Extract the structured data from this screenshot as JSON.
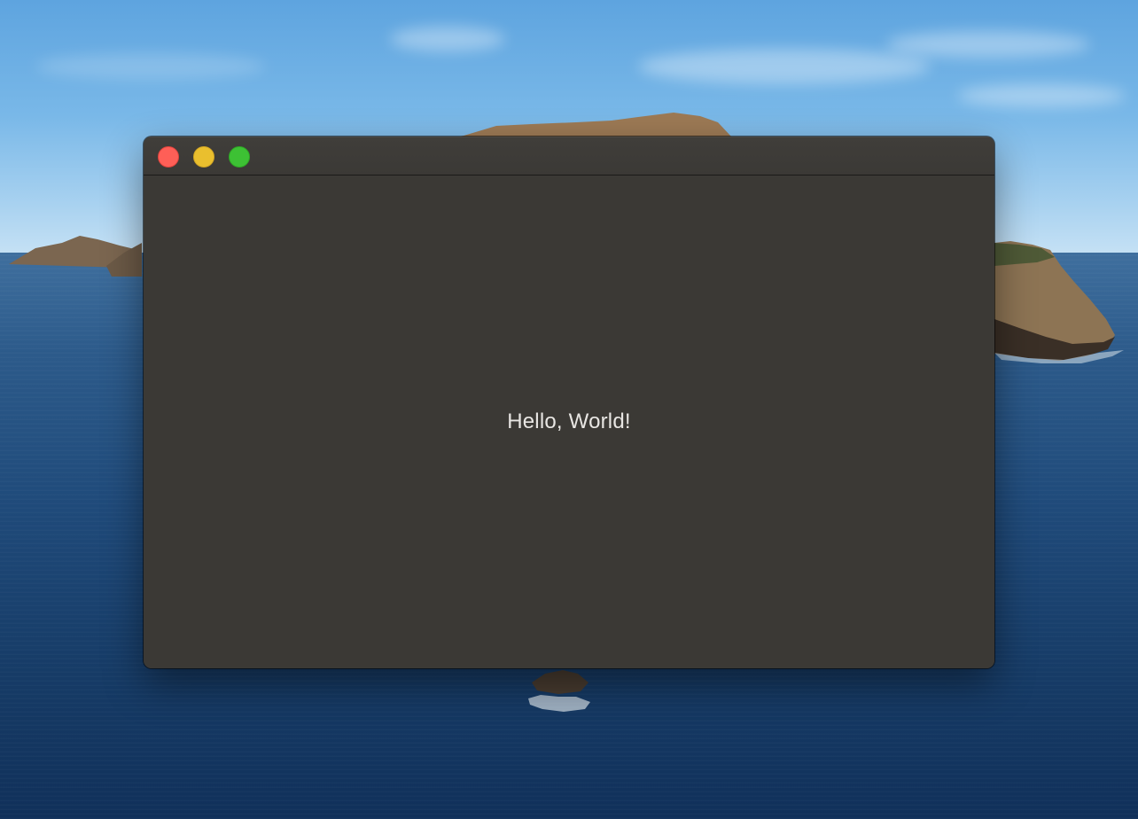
{
  "window": {
    "content_text": "Hello, World!"
  },
  "colors": {
    "window_background": "#3b3935",
    "content_text": "#e8e6e3",
    "close_button": "#fe5f57",
    "minimize_button": "#eabf2e",
    "zoom_button": "#3dc134"
  },
  "icons": {
    "close": "close-button",
    "minimize": "minimize-button",
    "zoom": "zoom-button"
  }
}
